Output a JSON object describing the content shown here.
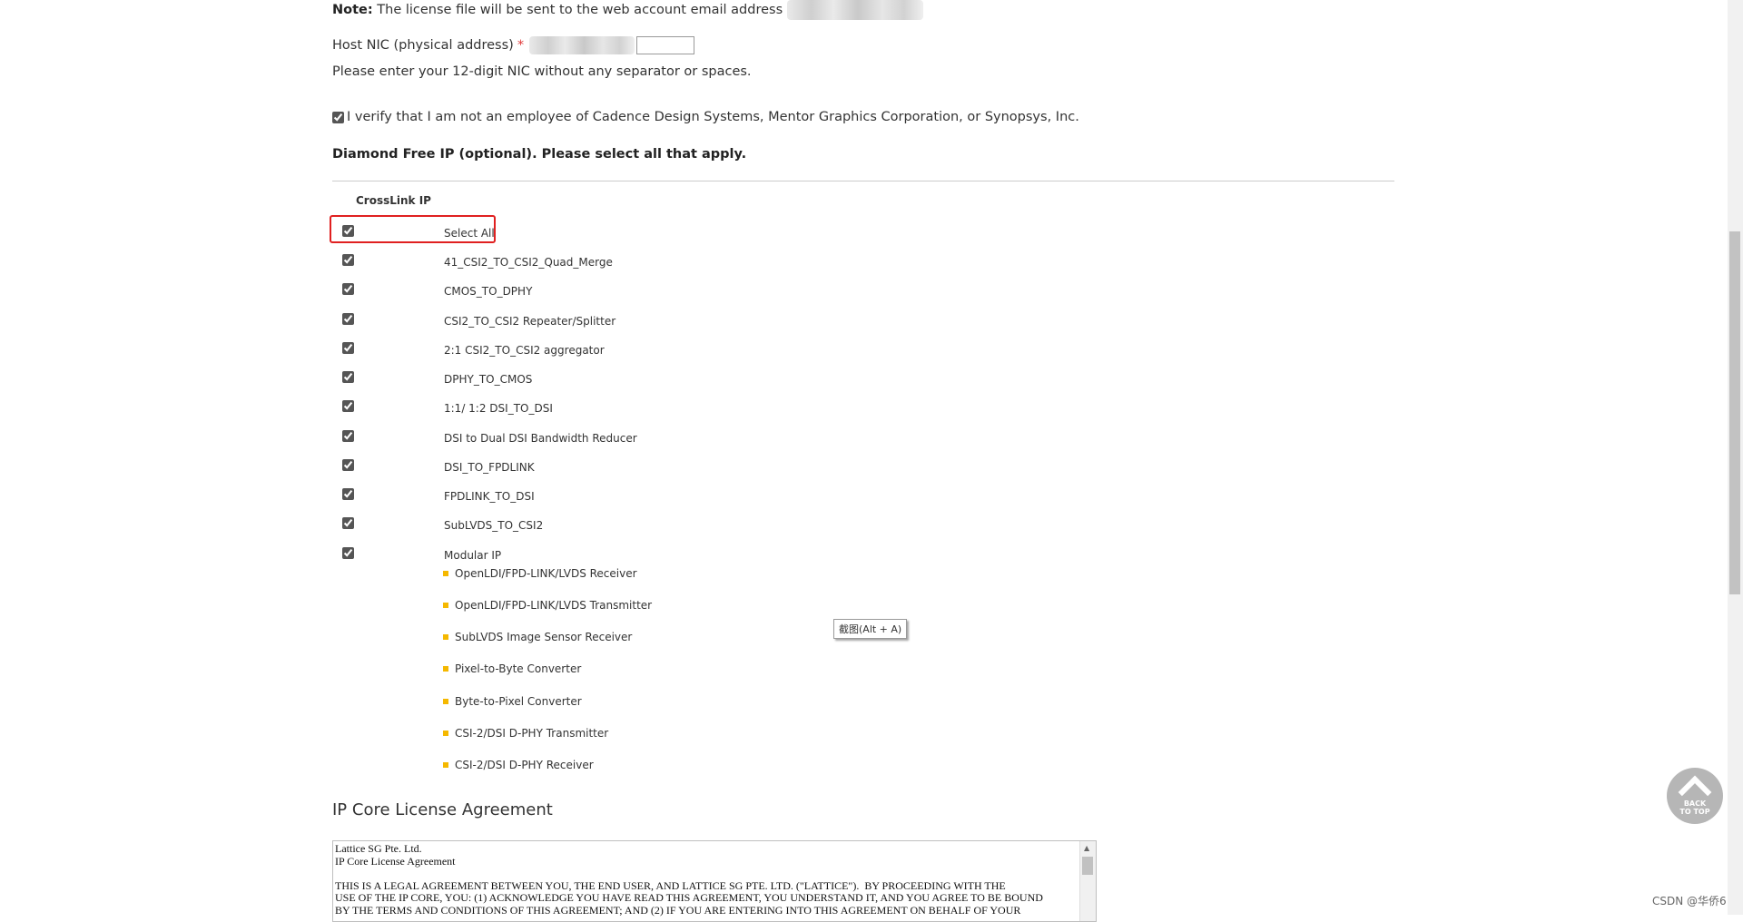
{
  "note": {
    "label": "Note:",
    "text": "The license file will be sent to the web account email address"
  },
  "host_nic": {
    "label": "Host NIC (physical address)",
    "required_mark": "*",
    "value": "",
    "hint": "Please enter your 12-digit NIC without any separator or spaces."
  },
  "verify": {
    "checked": true,
    "text": "I verify that I am not an employee of Cadence Design Systems, Mentor Graphics Corporation, or Synopsys, Inc."
  },
  "free_ip": {
    "heading": "Diamond Free IP (optional). Please select all that apply.",
    "group_label": "CrossLink IP",
    "select_all_label": "Select All",
    "items": [
      {
        "label": "41_CSI2_TO_CSI2_Quad_Merge",
        "checked": true
      },
      {
        "label": "CMOS_TO_DPHY",
        "checked": true
      },
      {
        "label": "CSI2_TO_CSI2 Repeater/Splitter",
        "checked": true
      },
      {
        "label": "2:1 CSI2_TO_CSI2 aggregator",
        "checked": true
      },
      {
        "label": "DPHY_TO_CMOS",
        "checked": true
      },
      {
        "label": "1:1/ 1:2 DSI_TO_DSI",
        "checked": true
      },
      {
        "label": "DSI to Dual DSI Bandwidth Reducer",
        "checked": true
      },
      {
        "label": "DSI_TO_FPDLINK",
        "checked": true
      },
      {
        "label": "FPDLINK_TO_DSI",
        "checked": true
      },
      {
        "label": "SubLVDS_TO_CSI2",
        "checked": true
      },
      {
        "label": "Modular IP",
        "checked": true
      }
    ],
    "modular_items": [
      "OpenLDI/FPD-LINK/LVDS Receiver",
      "OpenLDI/FPD-LINK/LVDS Transmitter",
      "SubLVDS Image Sensor Receiver",
      "Pixel-to-Byte Converter",
      "Byte-to-Pixel Converter",
      "CSI-2/DSI D-PHY Transmitter",
      "CSI-2/DSI D-PHY Receiver"
    ]
  },
  "tooltip": {
    "text": "截图(Alt + A)"
  },
  "license": {
    "heading": "IP Core License Agreement",
    "lines": [
      "Lattice SG Pte. Ltd.",
      "IP Core License Agreement",
      "",
      "THIS IS A LEGAL AGREEMENT BETWEEN YOU, THE END USER, AND LATTICE SG PTE. LTD. (\"LATTICE\").  BY PROCEEDING WITH THE",
      "USE OF THE IP CORE, YOU: (1) ACKNOWLEDGE YOU HAVE READ THIS AGREEMENT, YOU UNDERSTAND IT, AND YOU AGREE TO BE BOUND",
      "BY THE TERMS AND CONDITIONS OF THIS AGREEMENT; AND (2) IF YOU ARE ENTERING INTO THIS AGREEMENT ON BEHALF OF YOUR"
    ]
  },
  "back_to_top": {
    "line1": "BACK",
    "line2": "TO TOP"
  },
  "watermark": {
    "text": "CSDN @华侨6"
  },
  "colors": {
    "required": "#e03a3a",
    "highlight": "#e02020",
    "bullet": "#f5b800"
  }
}
